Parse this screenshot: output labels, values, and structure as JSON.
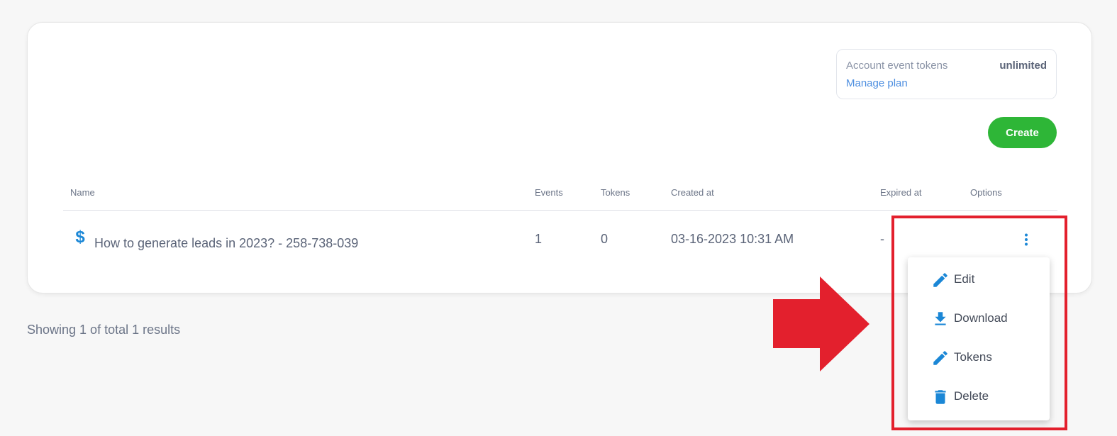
{
  "account": {
    "tokens_label": "Account event tokens",
    "tokens_value": "unlimited",
    "manage_plan": "Manage plan"
  },
  "toolbar": {
    "create_label": "Create"
  },
  "table": {
    "headers": {
      "name": "Name",
      "events": "Events",
      "tokens": "Tokens",
      "created_at": "Created at",
      "expired_at": "Expired at",
      "options": "Options"
    },
    "rows": [
      {
        "icon": "dollar-icon",
        "name": "How to generate leads in 2023? - 258-738-039",
        "events": "1",
        "tokens": "0",
        "created_at": "03-16-2023 10:31 AM",
        "expired_at": "-"
      }
    ]
  },
  "footer": {
    "results": "Showing 1 of total 1 results"
  },
  "options_menu": {
    "items": [
      {
        "label": "Edit",
        "icon": "pencil-icon"
      },
      {
        "label": "Download",
        "icon": "download-icon"
      },
      {
        "label": "Tokens",
        "icon": "pencil-icon"
      },
      {
        "label": "Delete",
        "icon": "trash-icon"
      }
    ]
  },
  "colors": {
    "accent": "#2eb637",
    "link": "#4e8fe0",
    "icon": "#1b87d6",
    "annotation": "#e3202d"
  }
}
